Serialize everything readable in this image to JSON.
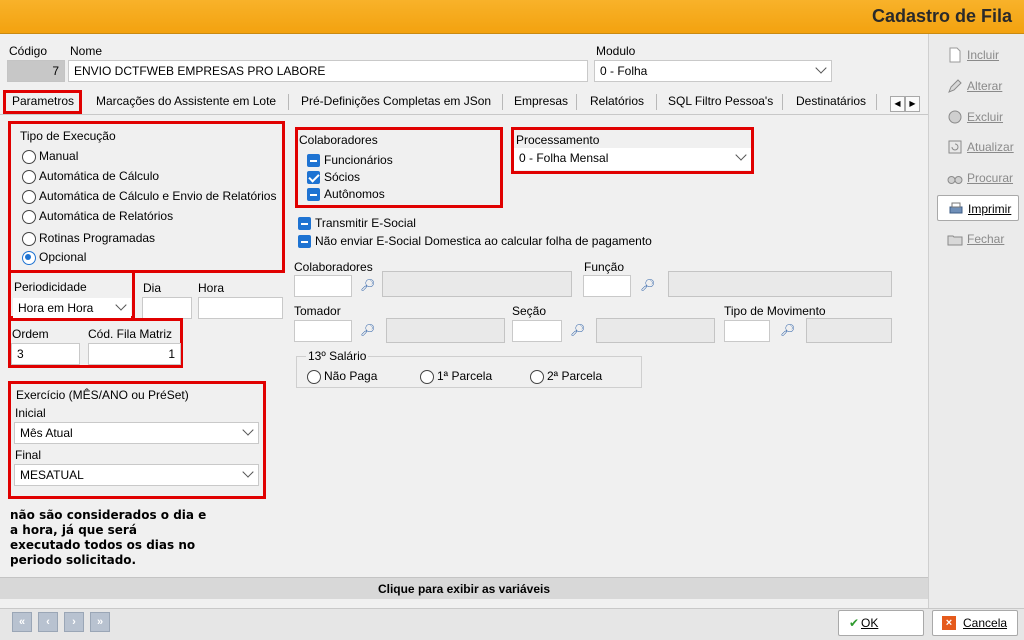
{
  "window": {
    "title": "Cadastro de Fila"
  },
  "header": {
    "codigo_label": "Código",
    "codigo_value": "7",
    "nome_label": "Nome",
    "nome_value": "ENVIO DCTFWEB EMPRESAS PRO LABORE",
    "modulo_label": "Modulo",
    "modulo_value": "0 - Folha"
  },
  "tabs": [
    {
      "label": "Parametros"
    },
    {
      "label": "Marcações do Assistente em Lote"
    },
    {
      "label": "Pré-Definições Completas em JSon"
    },
    {
      "label": "Empresas"
    },
    {
      "label": "Relatórios"
    },
    {
      "label": "SQL Filtro Pessoa's"
    },
    {
      "label": "Destinatários"
    }
  ],
  "tipo_execucao": {
    "title": "Tipo de Execução",
    "options": [
      {
        "label": "Manual",
        "checked": false
      },
      {
        "label": "Automática de Cálculo",
        "checked": false
      },
      {
        "label": "Automática de Cálculo e Envio de Relatórios",
        "checked": false
      },
      {
        "label": "Automática de Relatórios",
        "checked": false
      },
      {
        "label": "Rotinas Programadas",
        "checked": false
      },
      {
        "label": "Opcional",
        "checked": true
      }
    ]
  },
  "periodicidade": {
    "label": "Periodicidade",
    "value": "Hora em Hora",
    "dia_label": "Dia",
    "hora_label": "Hora"
  },
  "ordem": {
    "label": "Ordem",
    "value": "3",
    "cod_label": "Cód. Fila Matriz",
    "cod_value": "1"
  },
  "exercicio": {
    "title": "Exercício (MÊS/ANO ou PréSet)",
    "inicial_label": "Inicial",
    "inicial_value": "Mês Atual",
    "final_label": "Final",
    "final_value": "MESATUAL"
  },
  "note": "não são considerados o dia e a hora, já que será executado todos os dias no periodo solicitado.",
  "colaboradores_group": {
    "title": "Colaboradores",
    "items": [
      {
        "label": "Funcionários",
        "state": "minus"
      },
      {
        "label": "Sócios",
        "state": "check"
      },
      {
        "label": "Autônomos",
        "state": "minus"
      }
    ]
  },
  "processamento": {
    "label": "Processamento",
    "value": "0 - Folha Mensal"
  },
  "esocial": {
    "transmitir": "Transmitir E-Social",
    "nao_enviar": "Não enviar E-Social Domestica ao calcular folha de pagamento"
  },
  "filters": {
    "colaboradores_label": "Colaboradores",
    "funcao_label": "Função",
    "tomador_label": "Tomador",
    "secao_label": "Seção",
    "tipo_movimento_label": "Tipo de Movimento"
  },
  "salario13": {
    "title": "13º Salário",
    "options": [
      {
        "label": "Não Paga"
      },
      {
        "label": "1ª Parcela"
      },
      {
        "label": "2ª Parcela"
      }
    ]
  },
  "variables_bar": "Clique para exibir as variáveis",
  "side_buttons": [
    {
      "label": "Incluir",
      "icon": "new-document-icon",
      "enabled": false
    },
    {
      "label": "Alterar",
      "icon": "edit-icon",
      "enabled": false
    },
    {
      "label": "Excluir",
      "icon": "delete-icon",
      "enabled": false
    },
    {
      "label": "Atualizar",
      "icon": "refresh-icon",
      "enabled": false
    },
    {
      "label": "Procurar",
      "icon": "binoculars-icon",
      "enabled": false
    },
    {
      "label": "Imprimir",
      "icon": "printer-icon",
      "enabled": true
    },
    {
      "label": "Fechar",
      "icon": "close-folder-icon",
      "enabled": false
    }
  ],
  "bottom": {
    "ok_label": "OK",
    "cancel_label": "Cancela"
  },
  "colors": {
    "titlebar": "#f3a20f",
    "highlight": "#e00000",
    "accent": "#1e73d2"
  }
}
